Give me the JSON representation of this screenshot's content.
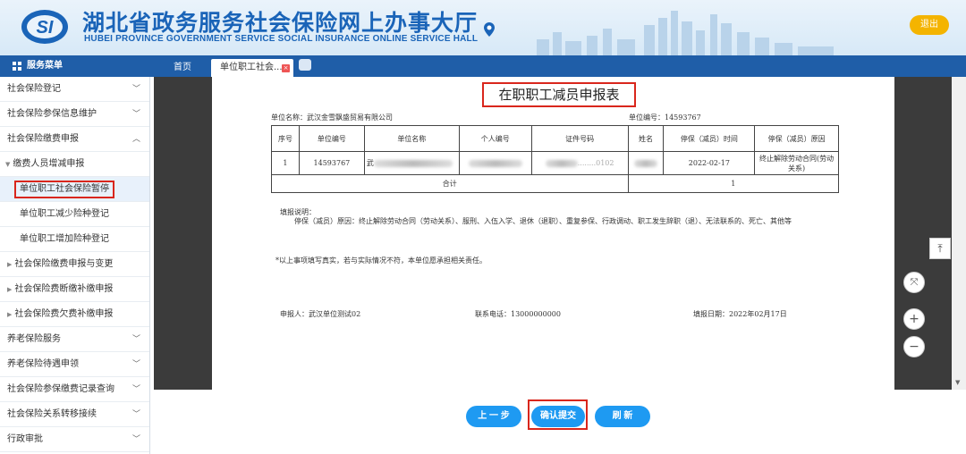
{
  "header": {
    "title_cn": "湖北省政务服务社会保险网上办事大厅",
    "title_en": "HUBEI PROVINCE GOVERNMENT SERVICE SOCIAL INSURANCE ONLINE SERVICE HALL",
    "logo_text": "SI",
    "logout_label": "退出",
    "brand_color": "#1a64b8",
    "logout_color": "#f4b400"
  },
  "nav": {
    "menu_label": "服务菜单",
    "tabs": [
      {
        "label": "首页",
        "active": false
      },
      {
        "label": "单位职工社会...",
        "active": true
      }
    ]
  },
  "sidebar": {
    "items": [
      {
        "label": "社会保险登记",
        "expanded": false
      },
      {
        "label": "社会保险参保信息维护",
        "expanded": false
      },
      {
        "label": "社会保险缴费申报",
        "expanded": true
      },
      {
        "label": "缴费人员增减申报",
        "expanded": true
      },
      {
        "label": "单位职工社会保险暂停",
        "active": true
      },
      {
        "label": "单位职工减少险种登记"
      },
      {
        "label": "单位职工增加险种登记"
      },
      {
        "label": "社会保险缴费申报与变更"
      },
      {
        "label": "社会保险费断缴补缴申报"
      },
      {
        "label": "社会保险费欠费补缴申报"
      },
      {
        "label": "养老保险服务",
        "expanded": false
      },
      {
        "label": "养老保险待遇申领",
        "expanded": false
      },
      {
        "label": "社会保险参保缴费记录查询",
        "expanded": false
      },
      {
        "label": "社会保险关系转移接续",
        "expanded": false
      },
      {
        "label": "行政审批",
        "expanded": false
      }
    ]
  },
  "document": {
    "title": "在职职工减员申报表",
    "unit_name_label": "单位名称：武汉金雪飘盛贸易有限公司",
    "unit_no_label": "单位编号：14593767",
    "columns": [
      "序号",
      "单位编号",
      "单位名称",
      "个人编号",
      "证件号码",
      "姓名",
      "停保（减员）时间",
      "停保（减员）原因"
    ],
    "row": {
      "seq": "1",
      "unit_no": "14593767",
      "unit_name_prefix": "武",
      "id_suffix": "........0102",
      "date": "2022-02-17",
      "reason": "终止解除劳动合同(劳动关系)"
    },
    "total_label": "合计",
    "total_value": "1",
    "note_title": "填报说明：",
    "note_body": "停保（减员）原因：终止解除劳动合同（劳动关系）、服刑、入伍入学、退休（退职）、重复参保、行政调动、职工发生辞职（退）、无法联系的、死亡、其他等",
    "declaration": "*以上事项填写真实，若与实际情况不符，本单位愿承担相关责任。",
    "applicant": "申报人：武汉单位测试02",
    "phone": "联系电话：13000000000",
    "fill_date": "填报日期：2022年02月17日"
  },
  "controls": {
    "top": "⤒",
    "fit": "⤧",
    "zoom_in": "+",
    "zoom_out": "−"
  },
  "buttons": {
    "prev": "上 一 步",
    "confirm": "确认提交",
    "refresh": "刷    新",
    "color": "#1e9af2"
  }
}
